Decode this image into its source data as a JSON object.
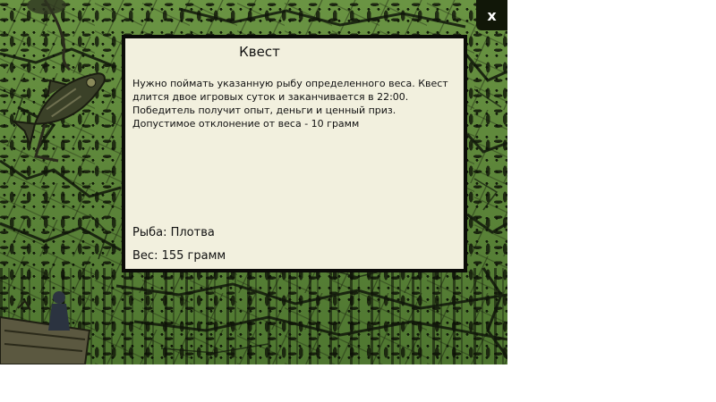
{
  "dialog": {
    "title": "Квест",
    "description": "Нужно поймать указанную рыбу определенного веса. Квест длится двое игровых суток и заканчивается в 22:00. Победитель получит опыт, деньги и ценный приз. Допустимое отклонение от веса - 10 грамм",
    "fish_line": "Рыба: Плотва",
    "weight_line": "Вес: 155 грамм"
  },
  "close_label": "x",
  "colors": {
    "background_green": "#5f8a3a",
    "crack_dark": "#111708",
    "dialog_bg": "#f2f0de",
    "dialog_border": "#0b0b08"
  },
  "icons": {
    "fish": "fish-decoration-icon",
    "boat": "boat-decoration-icon",
    "close": "close-icon"
  }
}
